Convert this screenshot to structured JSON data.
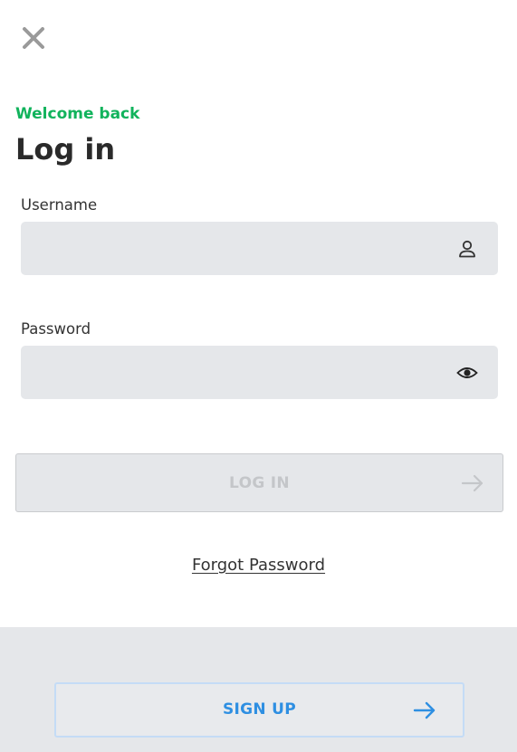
{
  "header": {
    "close_icon": "close-icon",
    "welcome": "Welcome back",
    "title": "Log in"
  },
  "form": {
    "username": {
      "label": "Username",
      "value": "",
      "placeholder": "",
      "icon": "user-icon"
    },
    "password": {
      "label": "Password",
      "value": "",
      "placeholder": "",
      "icon": "eye-icon"
    },
    "login_button": {
      "label": "LOG IN",
      "icon": "arrow-right-icon",
      "state": "disabled"
    },
    "forgot_password": "Forgot Password"
  },
  "footer": {
    "signup_button": {
      "label": "SIGN UP",
      "icon": "arrow-right-icon"
    }
  },
  "colors": {
    "accent_green": "#11b35c",
    "accent_blue": "#2e8fe2",
    "field_bg": "#e5e7ea",
    "text_dark": "#2a2a2a",
    "disabled_text": "#c4c6c9"
  }
}
